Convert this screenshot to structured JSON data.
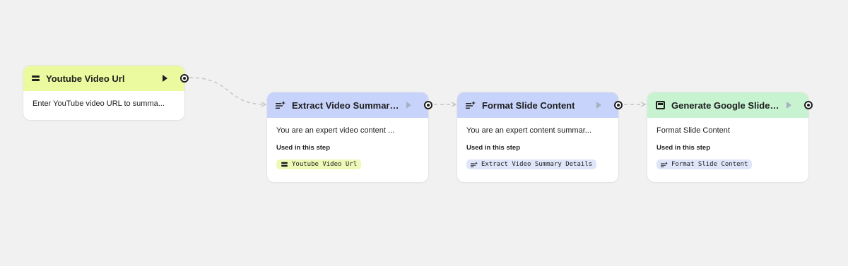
{
  "nodes": [
    {
      "id": "youtube-video-url",
      "title": "Youtube Video Url",
      "icon": "input-icon",
      "description": "Enter YouTube video URL to summa..."
    },
    {
      "id": "extract-video-summary",
      "title": "Extract Video Summary ...",
      "icon": "generate-text-icon",
      "description": "You are an expert video content ...",
      "used_label": "Used in this step",
      "chip": "Youtube Video Url"
    },
    {
      "id": "format-slide-content",
      "title": "Format Slide Content",
      "icon": "generate-text-icon",
      "description": "You are an expert content summar...",
      "used_label": "Used in this step",
      "chip": "Extract Video Summary Details"
    },
    {
      "id": "generate-google-slide",
      "title": "Generate Google Slide P...",
      "icon": "slides-icon",
      "description": "Format Slide Content",
      "used_label": "Used in this step",
      "chip": "Format Slide Content"
    }
  ],
  "colors": {
    "background": "#f1f1f1",
    "input_header": "#ebfa9e",
    "generate_header": "#c7d3fa",
    "output_header": "#c7f3d1",
    "edge": "#c4c4c4"
  }
}
